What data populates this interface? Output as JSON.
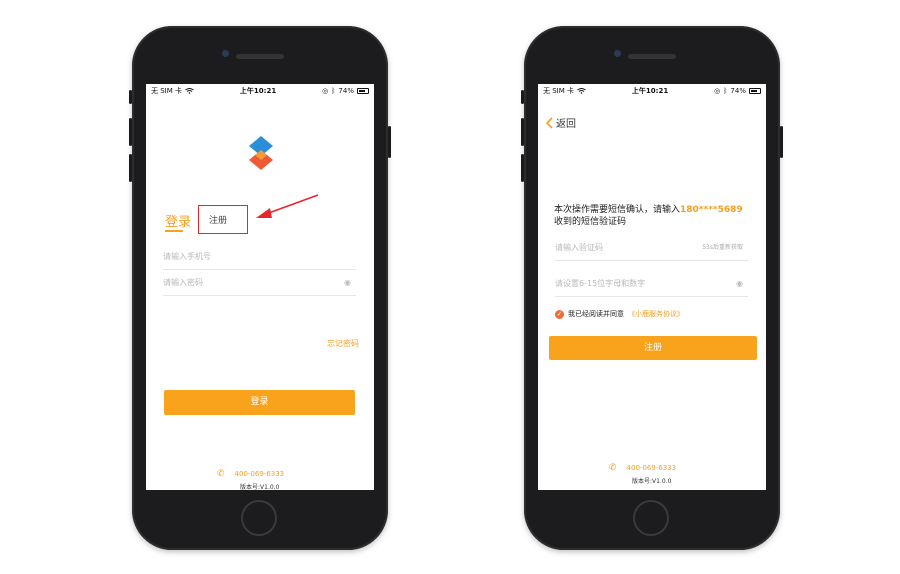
{
  "left_screen": {
    "status": {
      "carrier": "无 SIM 卡",
      "time": "上午10:21",
      "battery": "74%"
    },
    "logo": "app-logo",
    "tabs": {
      "login": "登录",
      "register": "注册"
    },
    "phone_placeholder": "请输入手机号",
    "password_placeholder": "请输入密码",
    "forgot": "忘记密码",
    "login_button": "登录",
    "hotline": "400-069-6333",
    "version": "版本号:V1.0.0"
  },
  "right_screen": {
    "status": {
      "carrier": "无 SIM 卡",
      "time": "上午10:21",
      "battery": "74%"
    },
    "back": "返回",
    "instruction_line1": "本次操作需要短信确认，请输入",
    "masked_phone": "180****5689",
    "instruction_line2": "收到的短信验证码",
    "code_placeholder": "请输入验证码",
    "countdown": "53s后重新获取",
    "password_placeholder": "请设置6-15位字母和数字",
    "agree_text": "我已经阅读并同意",
    "agreement_link": "《小鹿服务协议》",
    "register_button": "注册",
    "hotline": "400-069-6333",
    "version": "版本号:V1.0.0"
  },
  "colors": {
    "accent": "#f9a21c",
    "highlight_box": "#e8262a"
  }
}
